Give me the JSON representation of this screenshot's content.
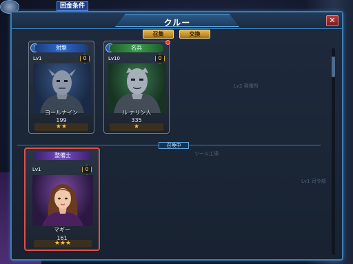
{
  "hud": {
    "condition_label": "回金条件"
  },
  "window": {
    "title": "クルー",
    "close_label": "✕",
    "tabs": [
      {
        "label": "召集"
      },
      {
        "label": "交換"
      }
    ],
    "divider_label": "召喚中"
  },
  "background_text": {
    "lv2_label": "Lv2 発電所",
    "tool_label": "ツール工場",
    "lv1_label": "Lv1 司令部"
  },
  "crew_cards": [
    {
      "role": "射撃",
      "level": "Lv1",
      "badge": "0",
      "name": "ヨールナイン",
      "power": "199",
      "stars": "★★",
      "header_color": "blue"
    },
    {
      "role": "名兵",
      "level": "Lv10",
      "badge": "0",
      "name": "ル ナリン人",
      "power": "335",
      "stars": "★",
      "header_color": "green"
    },
    {
      "role": "整備士",
      "level": "Lv1",
      "badge": "0",
      "name": "マギー",
      "power": "161",
      "stars": "★★★",
      "header_color": "purple"
    }
  ],
  "colors": {
    "accent": "#3a7fb8",
    "selected_border": "#e2504a",
    "star": "#f5c242",
    "tab_gold": "#e8b84c"
  }
}
